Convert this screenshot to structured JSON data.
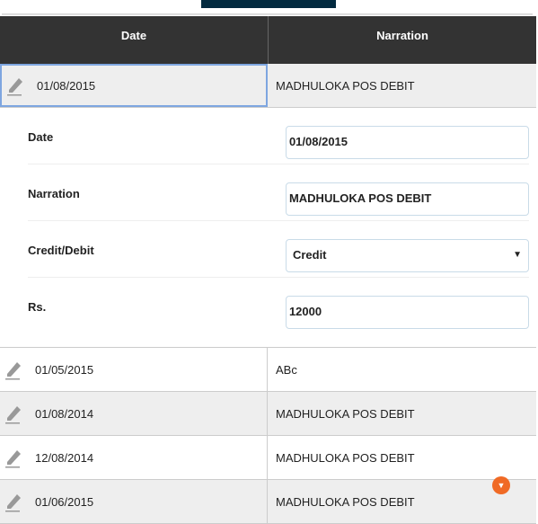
{
  "table": {
    "headers": [
      "Date",
      "Narration"
    ],
    "selected_row": {
      "date": "01/08/2015",
      "narration": "MADHULOKA POS DEBIT"
    },
    "rows": [
      {
        "date": "01/05/2015",
        "narration": "ABc"
      },
      {
        "date": "01/08/2014",
        "narration": "MADHULOKA POS DEBIT"
      },
      {
        "date": "12/08/2014",
        "narration": "MADHULOKA POS DEBIT"
      },
      {
        "date": "01/06/2015",
        "narration": "MADHULOKA POS DEBIT"
      }
    ]
  },
  "form": {
    "date_label": "Date",
    "date_value": "01/08/2015",
    "narration_label": "Narration",
    "narration_value": "MADHULOKA POS DEBIT",
    "type_label": "Credit/Debit",
    "type_value": "Credit",
    "amount_label": "Rs.",
    "amount_value": "12000"
  },
  "colors": {
    "header": "#333333",
    "accent": "#f06a25",
    "selection": "#7ea6e0"
  }
}
